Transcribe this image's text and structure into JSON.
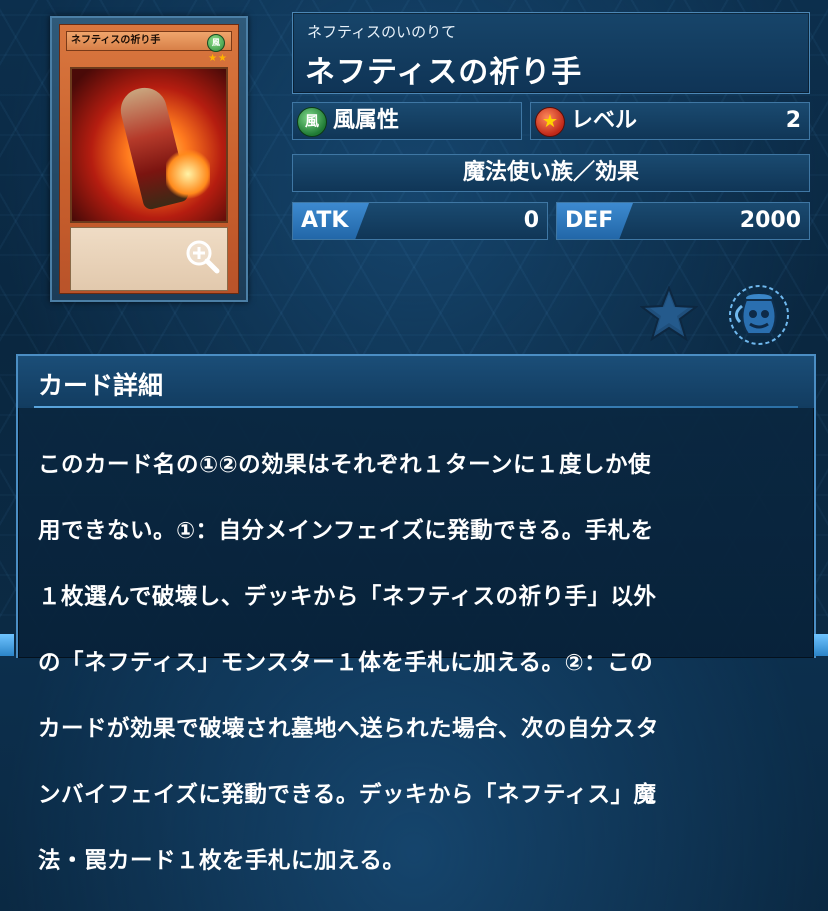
{
  "card": {
    "name_on_card": "ネフティスの祈り手",
    "attribute_glyph": "風",
    "stars": "★★"
  },
  "header": {
    "ruby": "ネフティスのいのりて",
    "name": "ネフティスの祈り手"
  },
  "attribute": {
    "icon": "風",
    "label": "風属性"
  },
  "level": {
    "icon": "★",
    "label": "レベル",
    "value": "2"
  },
  "type_line": "魔法使い族／効果",
  "stats": {
    "atk_label": "ATK",
    "atk_value": "0",
    "def_label": "DEF",
    "def_value": "2000"
  },
  "actions": {
    "favorite_icon": "star-icon",
    "deck_icon": "pot-icon",
    "zoom_icon": "zoom-in-icon"
  },
  "detail": {
    "title": "カード詳細",
    "lines": [
      "このカード名の①②の効果はそれぞれ１ターンに１度しか使",
      "用できない。①：自分メインフェイズに発動できる。手札を",
      "１枚選んで破壊し、デッキから「ネフティスの祈り手」以外",
      "の「ネフティス」モンスター１体を手札に加える。②：この",
      "カードが効果で破壊され墓地へ送られた場合、次の自分スタ",
      "ンバイフェイズに発動できる。デッキから「ネフティス」魔",
      "法・罠カード１枚を手札に加える。"
    ]
  },
  "colors": {
    "background": "#0b2a44",
    "panel": "#123c60",
    "panel_border": "#4c87b5",
    "stat_accent": "#2f7cc0",
    "wind": "#2e8a3a",
    "level": "#c0281a"
  }
}
